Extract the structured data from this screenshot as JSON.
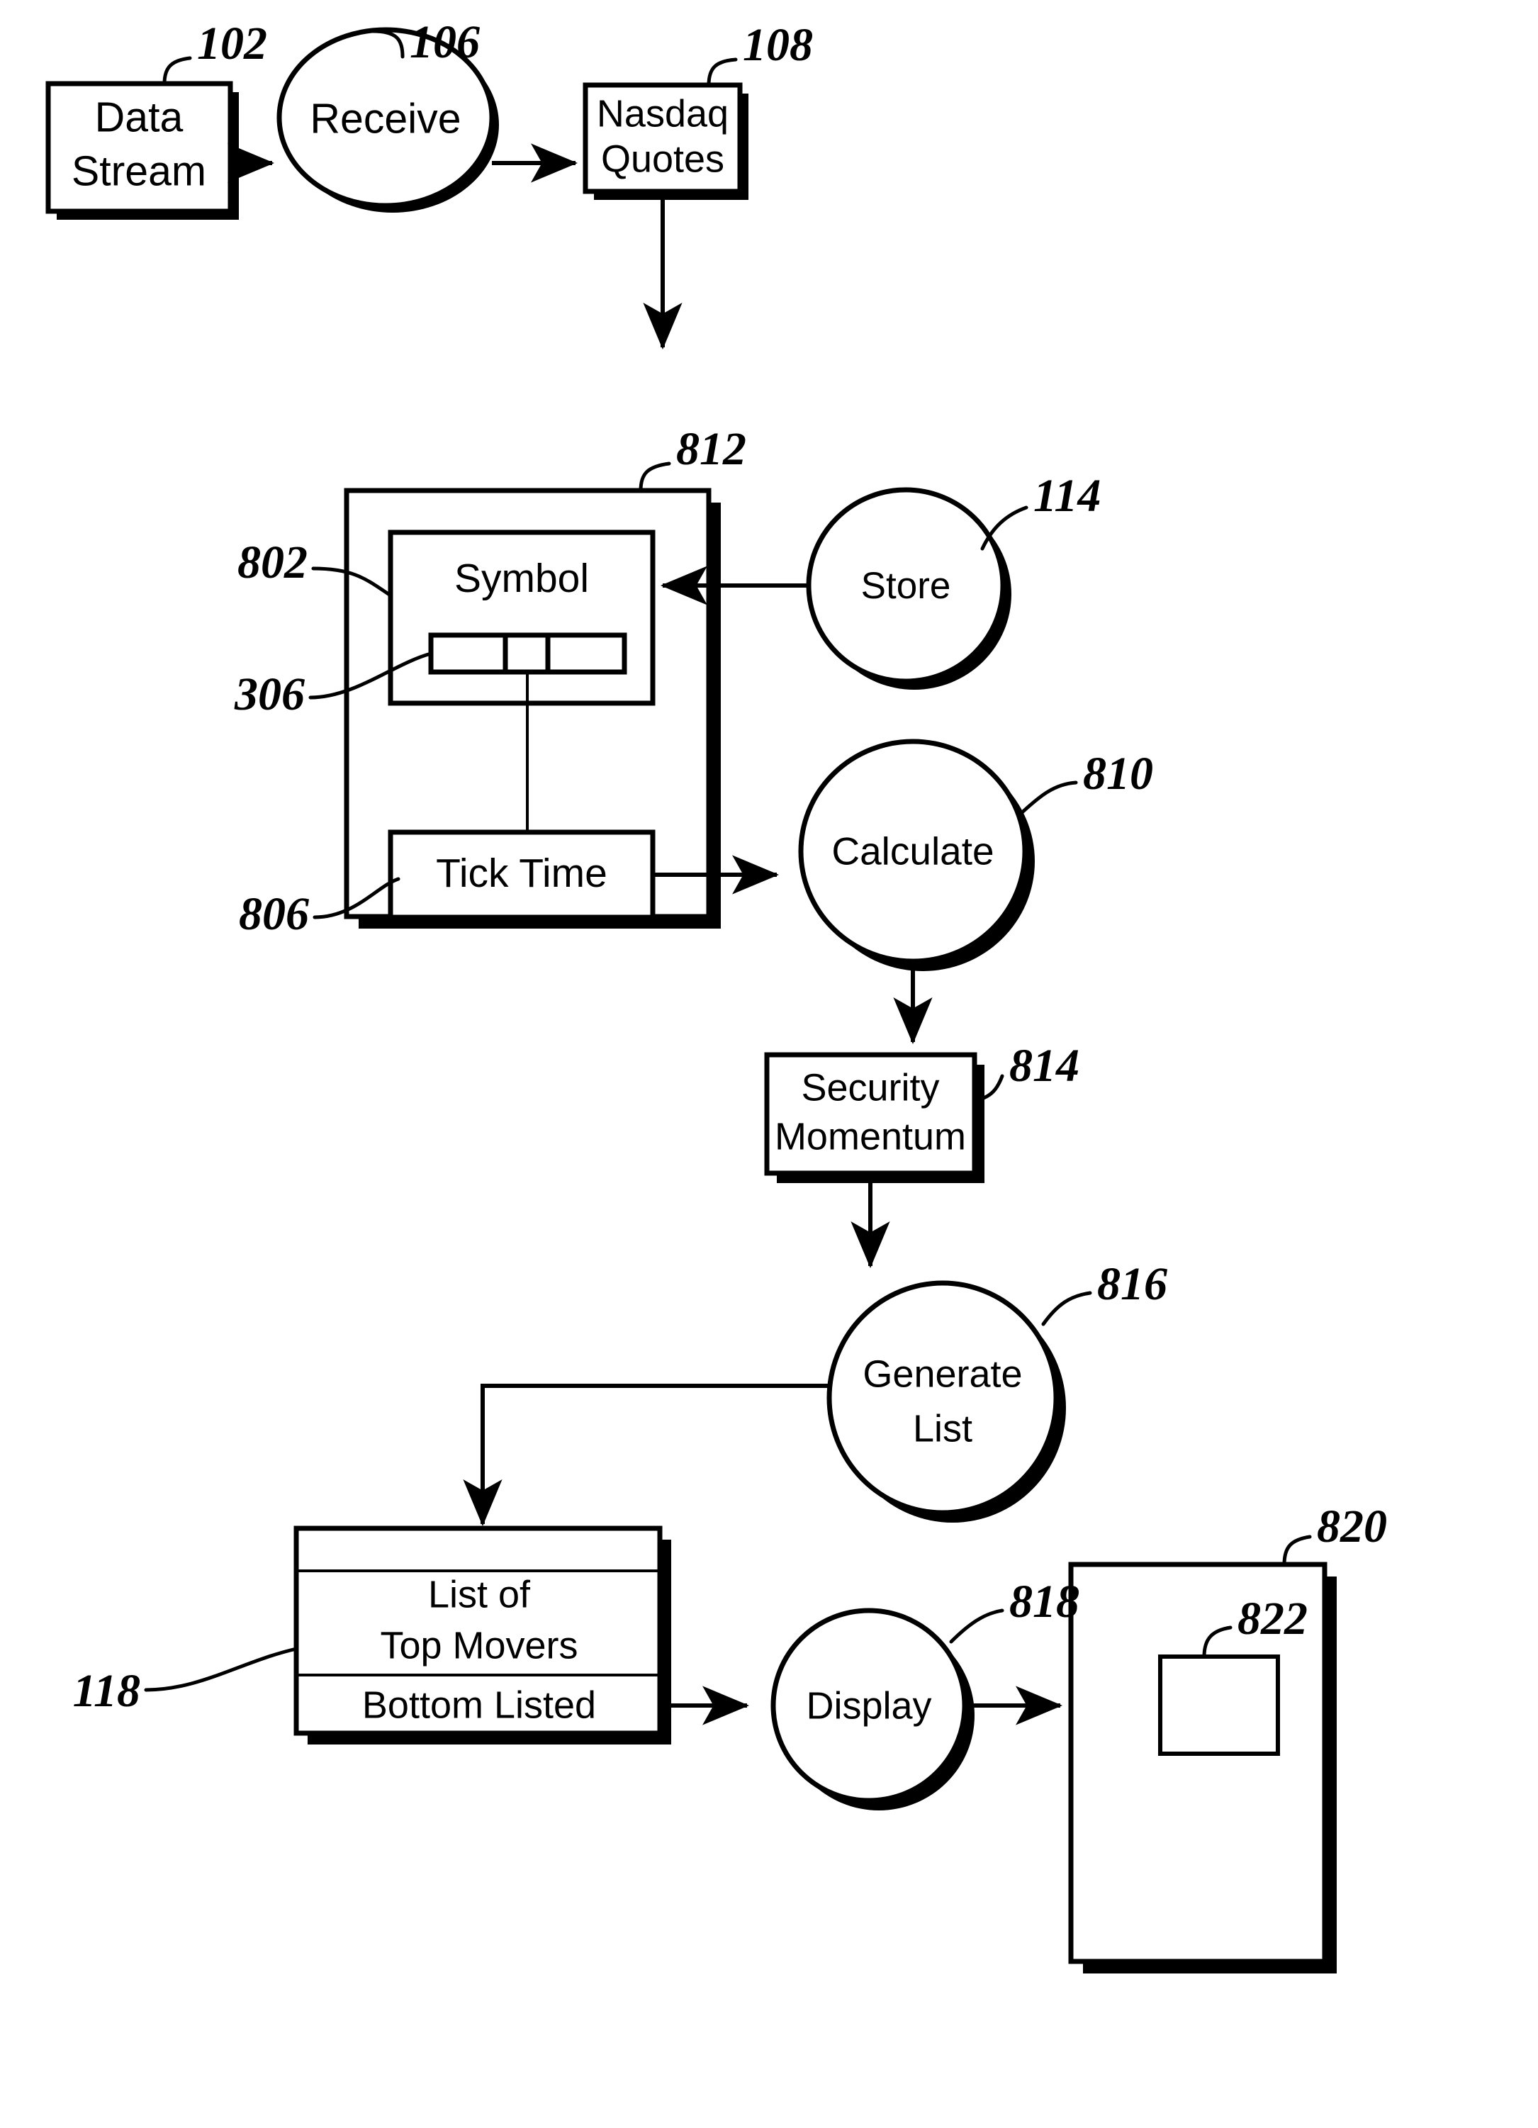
{
  "figure": {
    "type": "patent-flowchart",
    "background_color": "#ffffff",
    "ink_color": "#000000"
  },
  "nodes": {
    "data_stream": {
      "label_line1": "Data",
      "label_line2": "Stream",
      "ref": "102",
      "shape": "box"
    },
    "receive": {
      "label_line1": "Receive",
      "label_line2": "",
      "ref": "106",
      "shape": "ellipse"
    },
    "nasdaq_quotes": {
      "label_line1": "Nasdaq",
      "label_line2": "Quotes",
      "ref": "108",
      "shape": "box"
    },
    "store": {
      "label_line1": "Store",
      "label_line2": "",
      "ref": "114",
      "shape": "ellipse"
    },
    "record_group": {
      "label_line1": "",
      "label_line2": "",
      "ref": "812",
      "shape": "box"
    },
    "symbol": {
      "label_line1": "Symbol",
      "label_line2": "",
      "ref": "802",
      "shape": "box"
    },
    "segment_bar": {
      "label_line1": "",
      "label_line2": "",
      "ref": "306",
      "shape": "segmented-bar",
      "segments": 3
    },
    "tick_time": {
      "label_line1": "Tick Time",
      "label_line2": "",
      "ref": "806",
      "shape": "box"
    },
    "calculate": {
      "label_line1": "Calculate",
      "label_line2": "",
      "ref": "810",
      "shape": "ellipse"
    },
    "security_momentum": {
      "label_line1": "Security",
      "label_line2": "Momentum",
      "ref": "814",
      "shape": "box"
    },
    "generate_list": {
      "label_line1": "Generate",
      "label_line2": "List",
      "ref": "816",
      "shape": "ellipse"
    },
    "top_movers_list": {
      "label_cell_top": "",
      "label_line1": "List of",
      "label_line2": "Top Movers",
      "label_line3": "Bottom Listed",
      "ref": "118",
      "shape": "box-3cell"
    },
    "display": {
      "label_line1": "Display",
      "label_line2": "",
      "ref": "818",
      "shape": "ellipse"
    },
    "display_device": {
      "label_line1": "",
      "label_line2": "",
      "ref": "820",
      "shape": "box"
    },
    "display_window": {
      "label_line1": "",
      "label_line2": "",
      "ref": "822",
      "shape": "box"
    }
  },
  "ref_labels": [
    "102",
    "106",
    "108",
    "812",
    "802",
    "306",
    "114",
    "806",
    "810",
    "814",
    "816",
    "118",
    "818",
    "820",
    "822"
  ],
  "flow_edges": [
    {
      "from": "data_stream",
      "to": "receive"
    },
    {
      "from": "receive",
      "to": "nasdaq_quotes"
    },
    {
      "from": "nasdaq_quotes",
      "to": "store"
    },
    {
      "from": "store",
      "to": "symbol"
    },
    {
      "from": "tick_time",
      "to": "calculate"
    },
    {
      "from": "calculate",
      "to": "security_momentum"
    },
    {
      "from": "security_momentum",
      "to": "generate_list"
    },
    {
      "from": "generate_list",
      "to": "top_movers_list"
    },
    {
      "from": "top_movers_list",
      "to": "display"
    },
    {
      "from": "display",
      "to": "display_device"
    }
  ]
}
